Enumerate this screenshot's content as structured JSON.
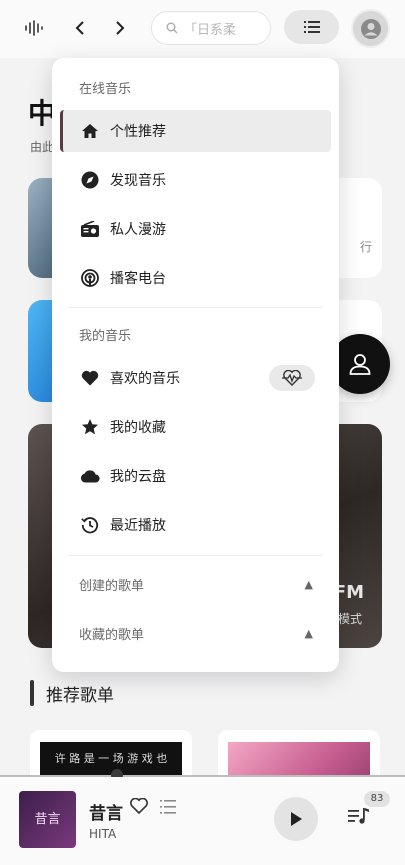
{
  "topbar": {
    "search_placeholder": "「日系柔"
  },
  "page": {
    "title_partial": "中",
    "subtitle_partial": "由此",
    "card_a_edge_text": "行",
    "fm_label": "FM",
    "fm_mode": "模式",
    "recommended_heading": "推荐歌单",
    "playlist_1_art_text": "许 路 是 一 场 游 戏 也"
  },
  "menu": {
    "online_section": "在线音乐",
    "online_items": [
      {
        "label": "个性推荐",
        "icon": "home-icon"
      },
      {
        "label": "发现音乐",
        "icon": "disc-icon"
      },
      {
        "label": "私人漫游",
        "icon": "radio-icon"
      },
      {
        "label": "播客电台",
        "icon": "podcast-icon"
      }
    ],
    "my_section": "我的音乐",
    "my_items": [
      {
        "label": "喜欢的音乐",
        "icon": "heart-icon"
      },
      {
        "label": "我的收藏",
        "icon": "star-icon"
      },
      {
        "label": "我的云盘",
        "icon": "cloud-icon"
      },
      {
        "label": "最近播放",
        "icon": "history-icon"
      }
    ],
    "created_playlists": "创建的歌单",
    "collected_playlists": "收藏的歌单"
  },
  "player": {
    "title": "昔言",
    "artist": "HITA",
    "cover_text": "昔言",
    "queue_count": "83",
    "progress": 0.29
  },
  "colors": {
    "active_marker": "#5a3a3e",
    "menu_bg": "#ffffff",
    "page_bg": "#f3f3f4"
  }
}
